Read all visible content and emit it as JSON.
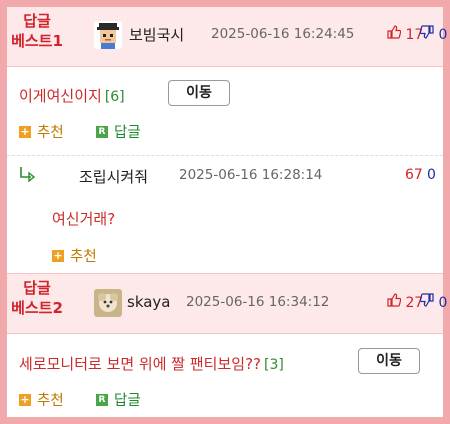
{
  "best1": {
    "badge_line1": "답글",
    "badge_line2": "베스트1",
    "nickname": "보빔국시",
    "timestamp": "2025-06-16 16:24:45",
    "upvotes": "17",
    "downvotes": "0",
    "content": "이게여신이지",
    "reply_count": "[6]",
    "move_label": "이동",
    "recommend_label": "추천",
    "reply_label": "답글"
  },
  "reply": {
    "nickname": "조립시켜줘",
    "timestamp": "2025-06-16 16:28:14",
    "upvotes": "67",
    "downvotes": "0",
    "content": "여신거래?",
    "recommend_label": "추천"
  },
  "best2": {
    "badge_line1": "답글",
    "badge_line2": "베스트2",
    "nickname": "skaya",
    "timestamp": "2025-06-16 16:34:12",
    "upvotes": "27",
    "downvotes": "0",
    "content": "세로모니터로 보면 위에 짤 팬티보임??",
    "reply_count": "[3]",
    "move_label": "이동",
    "recommend_label": "추천",
    "reply_label": "답글"
  },
  "icons": {
    "thumbs_up": "thumbs-up-icon",
    "thumbs_down": "thumbs-down-icon",
    "plus": "plus-icon",
    "reply_r": "reply-r-icon",
    "reply_arrow": "reply-arrow-icon"
  },
  "colors": {
    "border": "#f2a9ab",
    "best_bg": "#fde9ea",
    "badge_red": "#d2222a",
    "content_red": "#cc2b2b",
    "vote_blue": "#1f2ea6",
    "count_green": "#2e8b2e",
    "recommend_orange": "#c17a00"
  }
}
